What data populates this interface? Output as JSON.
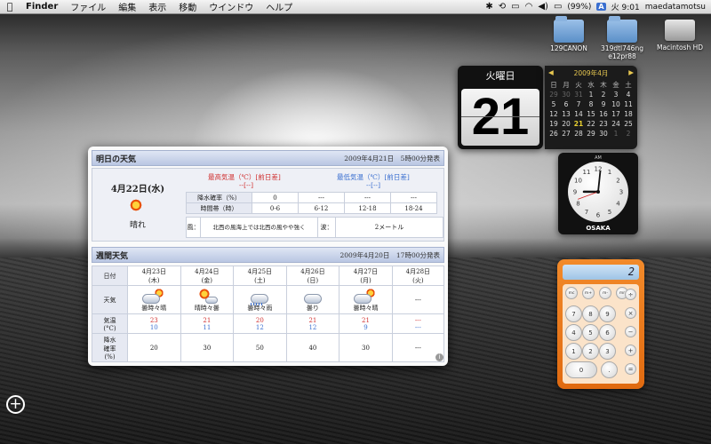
{
  "menubar": {
    "app": "Finder",
    "items": [
      "ファイル",
      "編集",
      "表示",
      "移動",
      "ウインドウ",
      "ヘルプ"
    ],
    "status": {
      "battery": "(99%)",
      "input": "A",
      "clock": "火 9:01",
      "user": "maedatamotsu"
    }
  },
  "desktop_icons": [
    {
      "label": "129CANON"
    },
    {
      "label": "319dtl746ng e12pr88"
    },
    {
      "label": "Macintosh HD"
    }
  ],
  "weather": {
    "tomorrow": {
      "title": "明日の天気",
      "issued": "2009年4月21日　5時00分発表",
      "date": "4月22日(水)",
      "condition": "晴れ",
      "max_label": "最高気温（℃）[前日差]",
      "max_val": "--[--]",
      "min_label": "最低気温（℃）[前日差]",
      "min_val": "--[--]",
      "rain_label": "降水確率（%）",
      "time_label": "時間帯（時）",
      "rain": [
        "0",
        "---",
        "---",
        "---"
      ],
      "periods": [
        "0-6",
        "6-12",
        "12-18",
        "18-24"
      ],
      "wind_label": "風：",
      "wind": "北西の風海上では北西の風やや強く",
      "wave_label": "波：",
      "wave": "2メートル"
    },
    "weekly": {
      "title": "週間天気",
      "issued": "2009年4月20日　17時00分発表",
      "row_labels": {
        "date": "日付",
        "weather": "天気",
        "temp": "気温\n(°C)",
        "pop": "降水\n確率\n(%)"
      },
      "days": [
        {
          "date": "4月23日\n(木)",
          "cond": "曇時々晴",
          "icon": "cloud-sun-icon",
          "max": "23",
          "min": "10",
          "pop": "20"
        },
        {
          "date": "4月24日\n(金)",
          "cond": "晴時々曇",
          "icon": "sun-cloud-icon",
          "max": "21",
          "min": "11",
          "pop": "30"
        },
        {
          "date": "4月25日\n(土)",
          "cond": "曇時々雨",
          "icon": "cloud-rain-icon",
          "max": "20",
          "min": "12",
          "pop": "50"
        },
        {
          "date": "4月26日\n(日)",
          "cond": "曇り",
          "icon": "cloud-icon",
          "max": "21",
          "min": "12",
          "pop": "40"
        },
        {
          "date": "4月27日\n(月)",
          "cond": "曇時々晴",
          "icon": "cloud-sun-icon",
          "max": "21",
          "min": "9",
          "pop": "30"
        },
        {
          "date": "4月28日\n(火)",
          "cond": "---",
          "icon": "",
          "max": "---",
          "min": "---",
          "pop": "---"
        }
      ]
    }
  },
  "date_widget": {
    "weekday": "火曜日",
    "day": "21"
  },
  "calendar": {
    "month": "2009年4月",
    "weekdays": [
      "日",
      "月",
      "火",
      "水",
      "木",
      "金",
      "土"
    ],
    "days": [
      "29",
      "30",
      "31",
      "1",
      "2",
      "3",
      "4",
      "5",
      "6",
      "7",
      "8",
      "9",
      "10",
      "11",
      "12",
      "13",
      "14",
      "15",
      "16",
      "17",
      "18",
      "19",
      "20",
      "21",
      "22",
      "23",
      "24",
      "25",
      "26",
      "27",
      "28",
      "29",
      "30",
      "1",
      "2"
    ],
    "today": "21"
  },
  "clock": {
    "ampm": "AM",
    "city": "OSAKA",
    "hour": 9,
    "minute": 1
  },
  "calculator": {
    "display": "2",
    "keys": [
      "mc",
      "m+",
      "m-",
      "mr",
      "÷",
      "7",
      "8",
      "9",
      "×",
      "4",
      "5",
      "6",
      "−",
      "1",
      "2",
      "3",
      "+",
      "0",
      ".",
      "C",
      "="
    ]
  }
}
